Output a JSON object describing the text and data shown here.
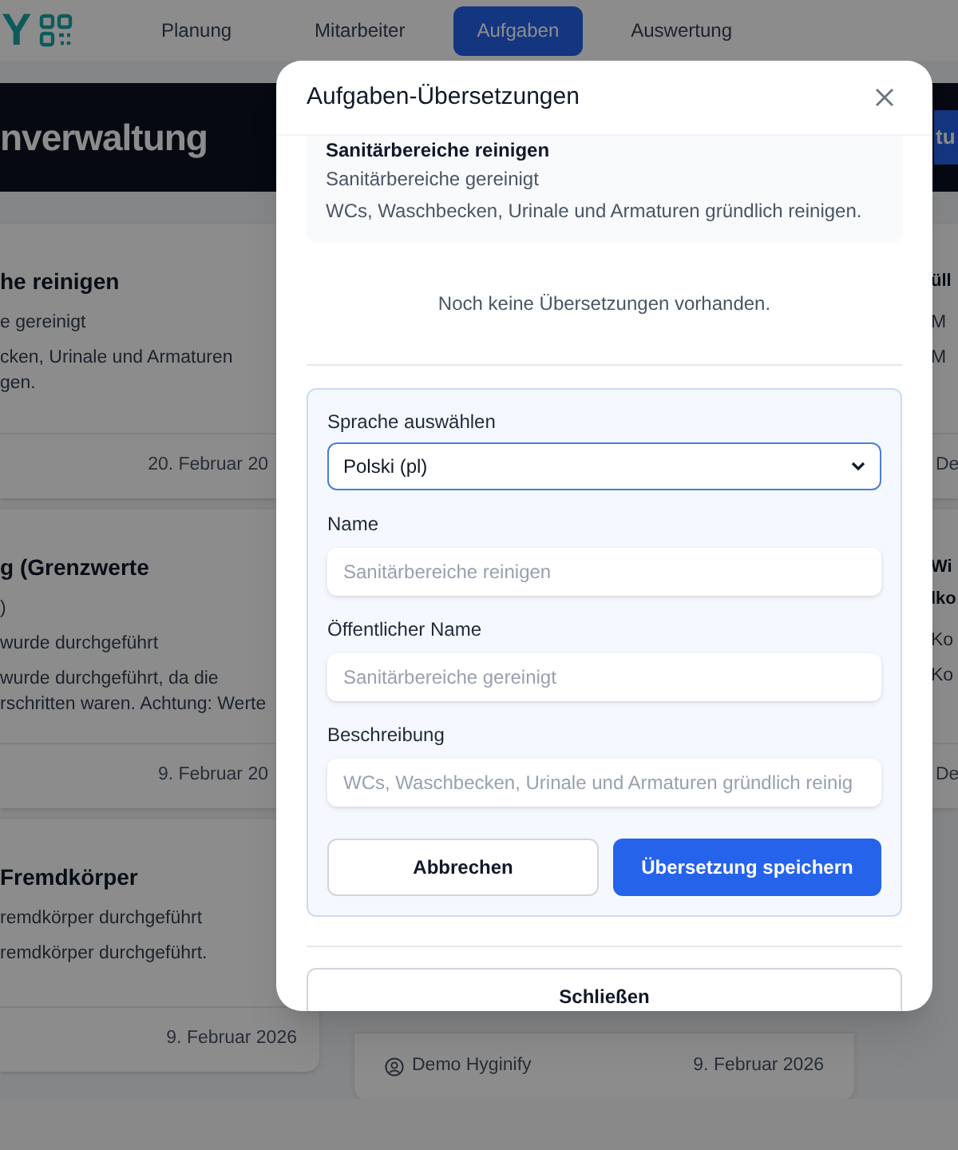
{
  "nav": {
    "logo_text": "Y",
    "tabs": [
      {
        "label": "Planung",
        "selected": false
      },
      {
        "label": "Mitarbeiter",
        "selected": false
      },
      {
        "label": "Aufgaben",
        "selected": true
      },
      {
        "label": "Auswertung",
        "selected": false
      }
    ]
  },
  "header": {
    "title": "nverwaltung",
    "button": "tu"
  },
  "cards": {
    "left": [
      {
        "title_lines": [
          "he reinigen"
        ],
        "lines": [
          "e gereinigt",
          "cken, Urinale und Armaturen\ngen."
        ],
        "date": "20. Februar 20"
      },
      {
        "title_lines": [
          "g (Grenzwerte"
        ],
        "lines": [
          ")",
          "wurde durchgeführt",
          "wurde durchgeführt, da die\nrschritten waren. Achtung: Werte"
        ],
        "date": "9. Februar 20"
      },
      {
        "title_lines": [
          "Fremdkörper"
        ],
        "lines": [
          "remdkörper durchgeführt",
          "remdkörper durchgeführt."
        ],
        "date": "9. Februar 2026"
      }
    ],
    "middle": [
      {
        "author": "Demo Hyginify",
        "date": "9. Februar 2026"
      }
    ],
    "right": [
      {
        "title_lines": [
          "üll"
        ],
        "lines": [
          "M",
          "M"
        ],
        "author": "De"
      },
      {
        "title_lines": [
          "Wi",
          "lko"
        ],
        "lines": [
          "Ko",
          "Ko"
        ],
        "author": "De"
      }
    ]
  },
  "dialog": {
    "title": "Aufgaben-Übersetzungen",
    "original": {
      "name": "Sanitärbereiche reinigen",
      "public_name": "Sanitärbereiche gereinigt",
      "description": "WCs, Waschbecken, Urinale und Armaturen gründlich reinigen."
    },
    "empty_message": "Noch keine Übersetzungen vorhanden.",
    "form": {
      "language_label": "Sprache auswählen",
      "language_value": "Polski (pl)",
      "fields": [
        {
          "label": "Name",
          "placeholder": "Sanitärbereiche reinigen"
        },
        {
          "label": "Öffentlicher Name",
          "placeholder": "Sanitärbereiche gereinigt"
        },
        {
          "label": "Beschreibung",
          "placeholder": "WCs, Waschbecken, Urinale und Armaturen gründlich reinig"
        }
      ],
      "cancel": "Abbrechen",
      "save": "Übersetzung speichern"
    },
    "close_button": "Schließen"
  }
}
